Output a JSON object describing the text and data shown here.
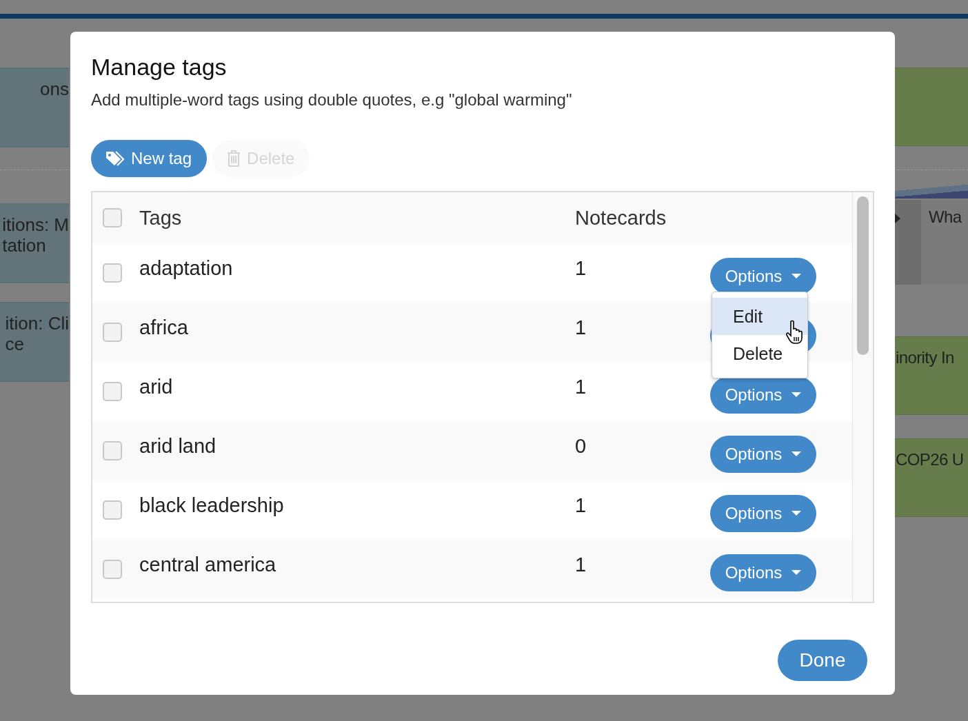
{
  "background": {
    "left_cards": [
      {
        "lines": [
          "ons"
        ]
      },
      {
        "lines": [
          "itions: M",
          "tation"
        ]
      },
      {
        "lines": [
          "ition: Cli",
          "ce"
        ]
      }
    ],
    "right_cards": [
      {
        "kind": "green"
      },
      {
        "kind": "grey",
        "lines": [
          "Wha"
        ]
      },
      {
        "kind": "green",
        "lines": [
          "inority In"
        ]
      },
      {
        "kind": "green",
        "lines": [
          "COP26 U"
        ]
      }
    ]
  },
  "dialog": {
    "title": "Manage tags",
    "subtitle": "Add multiple-word tags using double quotes, e.g \"global warming\"",
    "toolbar": [
      {
        "kind": "primary",
        "label": "New tag",
        "disabled": false
      },
      {
        "kind": "delete",
        "label": "Delete",
        "disabled": true
      }
    ],
    "table": {
      "columns": [
        "Tags",
        "Notecards"
      ],
      "header_checked": false,
      "rows": [
        {
          "tag": "adaptation",
          "count": "1",
          "checked": false,
          "options": "Options"
        },
        {
          "tag": "africa",
          "count": "1",
          "checked": false
        },
        {
          "tag": "arid",
          "count": "1",
          "checked": false,
          "options": "Options"
        },
        {
          "tag": "arid land",
          "count": "0",
          "checked": false,
          "options": "Options"
        },
        {
          "tag": "black leadership",
          "count": "1",
          "checked": false,
          "options": "Options"
        },
        {
          "tag": "central america",
          "count": "1",
          "checked": false,
          "options": "Options"
        }
      ]
    },
    "menu": {
      "items": [
        {
          "label": "Edit",
          "highlighted": true
        },
        {
          "label": "Delete",
          "highlighted": false
        }
      ]
    },
    "done": "Done"
  }
}
